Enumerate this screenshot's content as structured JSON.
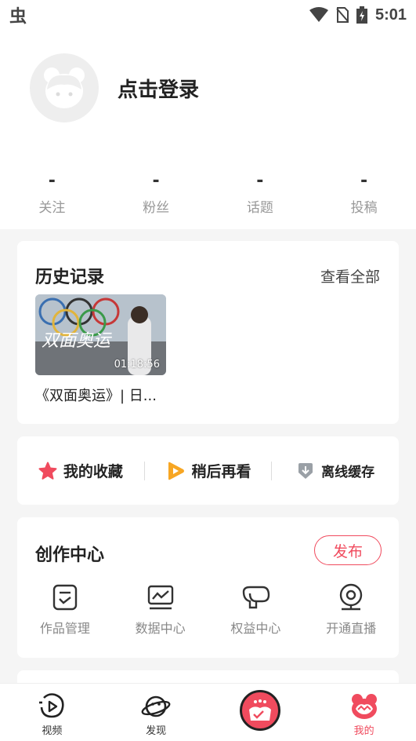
{
  "status_bar": {
    "left_glyph": "虫",
    "time": "5:01",
    "icons": [
      "wifi-icon",
      "no-sim-icon",
      "battery-charging-icon"
    ]
  },
  "profile": {
    "login_label": "点击登录"
  },
  "stats": [
    {
      "value": "-",
      "label": "关注"
    },
    {
      "value": "-",
      "label": "粉丝"
    },
    {
      "value": "-",
      "label": "话题"
    },
    {
      "value": "-",
      "label": "投稿"
    }
  ],
  "history": {
    "title": "历史记录",
    "view_all": "查看全部",
    "items": [
      {
        "title": "《双面奥运》| 日...",
        "duration": "01:18:56"
      }
    ]
  },
  "quick_actions": [
    {
      "label": "我的收藏",
      "icon": "star-icon"
    },
    {
      "label": "稍后再看",
      "icon": "play-later-icon"
    },
    {
      "label": "离线缓存",
      "icon": "download-icon"
    }
  ],
  "creation": {
    "title": "创作中心",
    "publish_label": "发布",
    "tools": [
      {
        "label": "作品管理",
        "icon": "works-icon"
      },
      {
        "label": "数据中心",
        "icon": "chart-icon"
      },
      {
        "label": "权益中心",
        "icon": "benefits-icon"
      },
      {
        "label": "开通直播",
        "icon": "live-camera-icon"
      }
    ]
  },
  "tabbar": {
    "tabs": [
      {
        "label": "视频",
        "icon": "video-icon"
      },
      {
        "label": "发现",
        "icon": "planet-icon"
      },
      {
        "label": "",
        "icon": "center-cat-icon"
      },
      {
        "label": "我的",
        "icon": "mine-icon",
        "active": true
      }
    ]
  },
  "colors": {
    "accent": "#f04b5e",
    "star": "#f04b5e",
    "play_later": "#f7a623",
    "download": "#9aa0a6"
  }
}
